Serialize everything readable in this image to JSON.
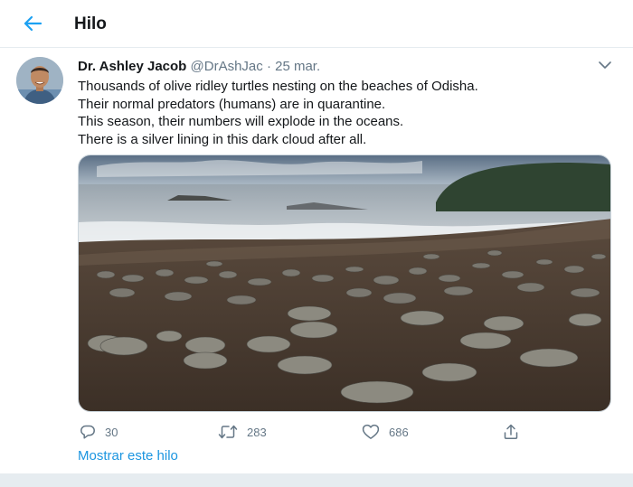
{
  "header": {
    "title": "Hilo",
    "back_icon": "arrow-left-icon",
    "accent": "#1da1f2"
  },
  "tweet": {
    "author_name": "Dr. Ashley Jacob",
    "handle": "@DrAshJac",
    "separator": "·",
    "date": "25 mar.",
    "text_lines": [
      "Thousands of olive ridley turtles nesting on the beaches of Odisha.",
      "Their normal predators (humans) are in quarantine.",
      "This season, their numbers will explode in the oceans.",
      "There is a silver lining in this dark cloud after all."
    ],
    "media_subject": "olive ridley turtles on a dark sandy beach",
    "actions": {
      "replies": "30",
      "retweets": "283",
      "likes": "686",
      "icons": [
        "reply-icon",
        "retweet-icon",
        "like-icon",
        "share-icon"
      ]
    },
    "show_thread": "Mostrar este hilo"
  },
  "colors": {
    "link": "#1b95e0",
    "secondary_text": "#657786",
    "divider": "#e6ecf0"
  }
}
